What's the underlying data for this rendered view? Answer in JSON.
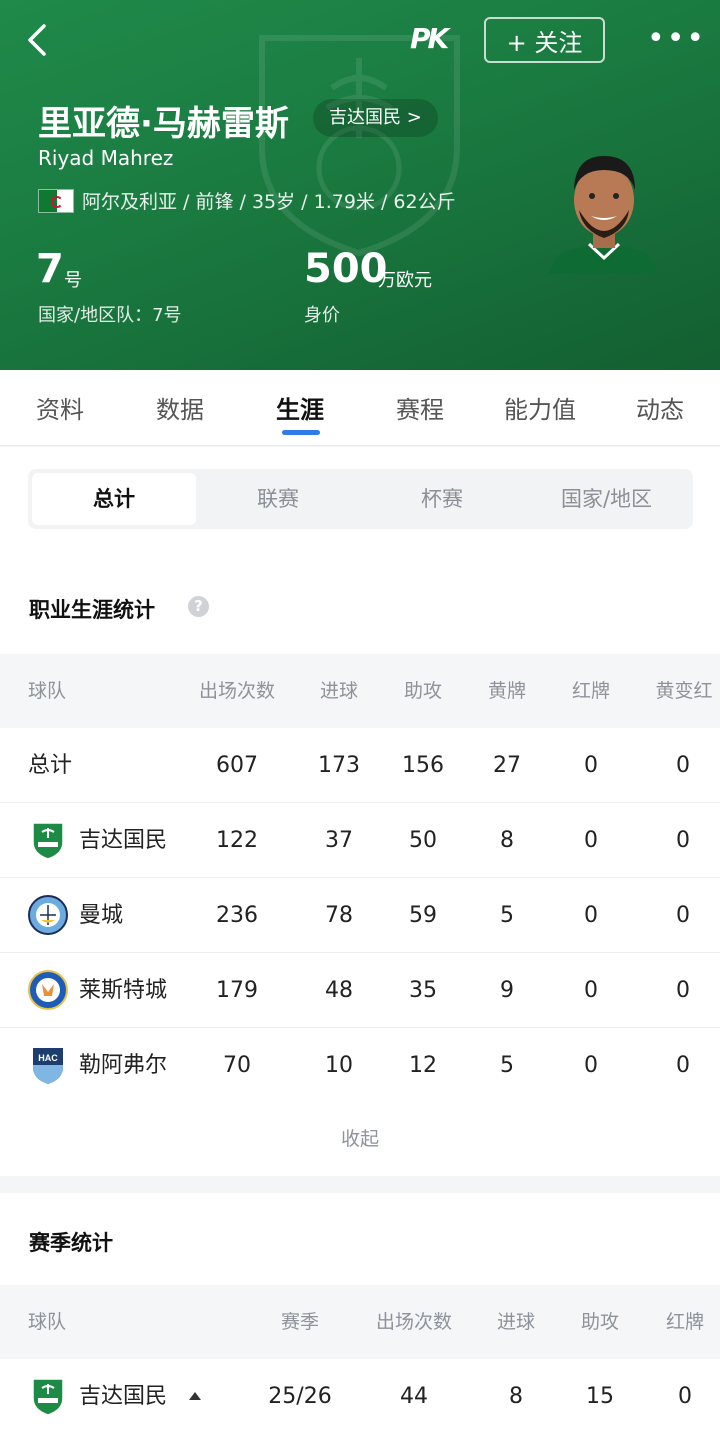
{
  "header": {
    "follow_label": "+ 关注",
    "more_label": "•••",
    "logo_text": "PK",
    "player_name_cn": "里亚德·马赫雷斯",
    "player_name_en": "Riyad Mahrez",
    "club_pill": "吉达国民 >",
    "info": "阿尔及利亚 / 前锋 / 35岁 / 1.79米 / 62公斤",
    "shirt_number": "7",
    "shirt_unit": "号",
    "national_number": "国家/地区队：7号",
    "value": "500",
    "value_unit": "万欧元",
    "value_label": "身价",
    "colors": {
      "hero_green": "#1a7a40",
      "accent_blue": "#2f7be9"
    }
  },
  "tabs": [
    "资料",
    "数据",
    "生涯",
    "赛程",
    "能力值",
    "动态"
  ],
  "active_tab": "生涯",
  "segments": [
    "总计",
    "联赛",
    "杯赛",
    "国家/地区"
  ],
  "career": {
    "title": "职业生涯统计",
    "columns": [
      "球队",
      "出场次数",
      "进球",
      "助攻",
      "黄牌",
      "红牌",
      "黄变红"
    ],
    "rows": [
      {
        "team": "总计",
        "apps": "607",
        "goals": "173",
        "assists": "156",
        "yellow": "27",
        "red": "0",
        "second_yellow": "0"
      },
      {
        "team": "吉达国民",
        "badge": "al-ahli-badge",
        "apps": "122",
        "goals": "37",
        "assists": "50",
        "yellow": "8",
        "red": "0",
        "second_yellow": "0"
      },
      {
        "team": "曼城",
        "badge": "man-city-badge",
        "apps": "236",
        "goals": "78",
        "assists": "59",
        "yellow": "5",
        "red": "0",
        "second_yellow": "0"
      },
      {
        "team": "莱斯特城",
        "badge": "leicester-badge",
        "apps": "179",
        "goals": "48",
        "assists": "35",
        "yellow": "9",
        "red": "0",
        "second_yellow": "0"
      },
      {
        "team": "勒阿弗尔",
        "badge": "le-havre-badge",
        "apps": "70",
        "goals": "10",
        "assists": "12",
        "yellow": "5",
        "red": "0",
        "second_yellow": "0"
      }
    ],
    "collapse_label": "收起"
  },
  "season": {
    "title": "赛季统计",
    "columns": [
      "球队",
      "赛季",
      "出场次数",
      "进球",
      "助攻",
      "红牌"
    ],
    "rows": [
      {
        "team": "吉达国民",
        "badge": "al-ahli-badge",
        "season": "25/26",
        "apps": "44",
        "goals": "8",
        "assists": "15",
        "red": "0"
      }
    ]
  }
}
